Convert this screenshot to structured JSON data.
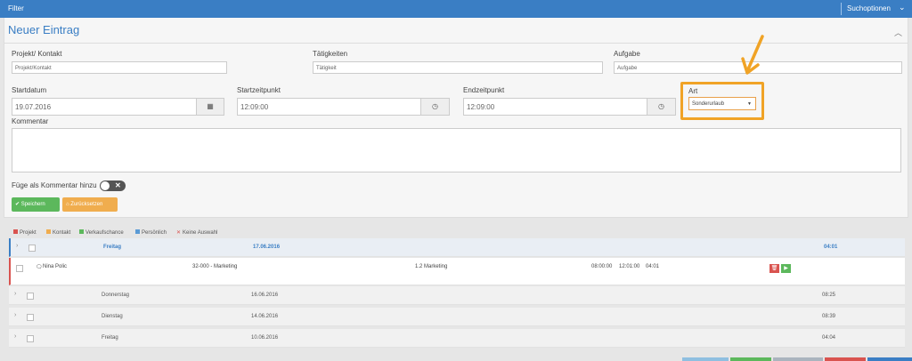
{
  "topbar": {
    "filter_label": "Filter",
    "search_options_label": "Suchoptionen",
    "chevron": "⌄"
  },
  "form": {
    "title": "Neuer Eintrag",
    "projekt": {
      "label": "Projekt/ Kontakt",
      "placeholder": "Projekt/Kontakt"
    },
    "taetigkeiten": {
      "label": "Tätigkeiten",
      "placeholder": "Tätigkeit"
    },
    "aufgabe": {
      "label": "Aufgabe",
      "placeholder": "Aufgabe"
    },
    "startdatum": {
      "label": "Startdatum",
      "value": "19.07.2016"
    },
    "startzeitpunkt": {
      "label": "Startzeitpunkt",
      "value": "12:09:00"
    },
    "endzeitpunkt": {
      "label": "Endzeitpunkt",
      "value": "12:09:00"
    },
    "art": {
      "label": "Art",
      "value": "Sonderurlaub",
      "arrow": "▼"
    },
    "kommentar": {
      "label": "Kommentar",
      "value": ""
    },
    "toggle_label": "Füge als Kommentar hinzu",
    "save_label": "Speichern",
    "reset_label": "Zurücksetzen"
  },
  "legend": [
    {
      "label": "Projekt",
      "color": "#d9534f"
    },
    {
      "label": "Kontakt",
      "color": "#f0ad4e"
    },
    {
      "label": "Verkaufschance",
      "color": "#5cb85c"
    },
    {
      "label": "Persönlich",
      "color": "#5b9bd5"
    },
    {
      "label": "Keine Auswahl",
      "color": "#d9534f"
    }
  ],
  "days": [
    {
      "day": "Freitag",
      "date": "17.06.2016",
      "total": "04:01"
    },
    {
      "day": "Donnerstag",
      "date": "16.06.2016",
      "total": "08:25"
    },
    {
      "day": "Dienstag",
      "date": "14.06.2016",
      "total": "08:39"
    },
    {
      "day": "Freitag",
      "date": "10.06.2016",
      "total": "04:04"
    }
  ],
  "entry": {
    "user": "Nina Polic",
    "project": "32-000 - Marketing",
    "task": "1.2 Marketing",
    "start": "08:00:00",
    "end": "12:01:00",
    "duration": "04:01"
  },
  "colors": {
    "accent": "#3a7ec4",
    "highlight": "#f0a326",
    "save": "#5cb85c",
    "reset": "#f0ad4e"
  }
}
